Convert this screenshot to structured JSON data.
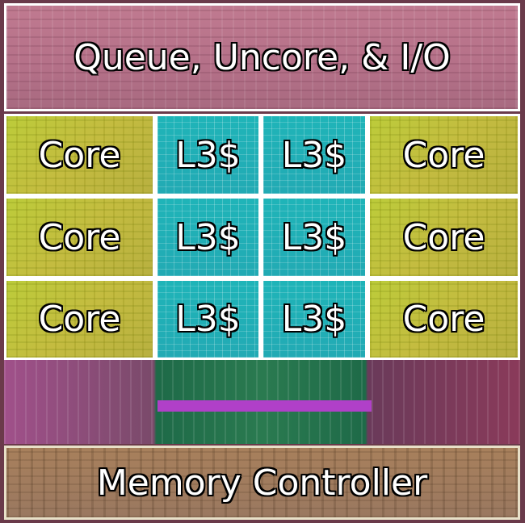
{
  "uncore": {
    "label": "Queue, Uncore, & I/O",
    "color": "#b47088"
  },
  "rows": [
    {
      "left": "Core",
      "cache_a": "L3$",
      "cache_b": "L3$",
      "right": "Core"
    },
    {
      "left": "Core",
      "cache_a": "L3$",
      "cache_b": "L3$",
      "right": "Core"
    },
    {
      "left": "Core",
      "cache_a": "L3$",
      "cache_b": "L3$",
      "right": "Core"
    }
  ],
  "memory_controller": {
    "label": "Memory Controller",
    "color": "#9a7860"
  },
  "colors": {
    "core": "#c0c040",
    "l3_cache": "#22aab4",
    "border": "#ffffff"
  }
}
